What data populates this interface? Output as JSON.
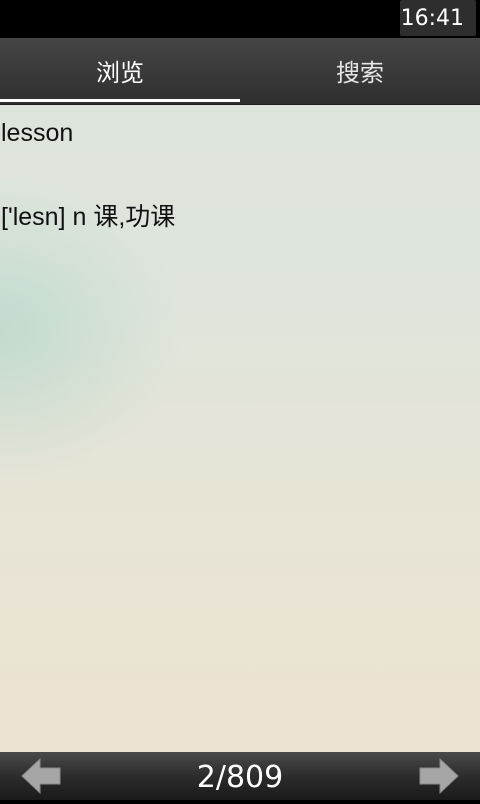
{
  "status_bar": {
    "time": "16:41"
  },
  "tabs": [
    {
      "label": "浏览",
      "selected": true
    },
    {
      "label": "搜索",
      "selected": false
    }
  ],
  "entry": {
    "word": "lesson",
    "definition": "['lesn] n 课,功课"
  },
  "navigation": {
    "page_indicator": "2/809",
    "prev_icon": "left-arrow-icon",
    "next_icon": "right-arrow-icon"
  },
  "colors": {
    "bar_dark": "#2f2f2f",
    "tab_indicator": "#ffffff",
    "text": "#111111",
    "arrow": "#a6a6a6"
  }
}
